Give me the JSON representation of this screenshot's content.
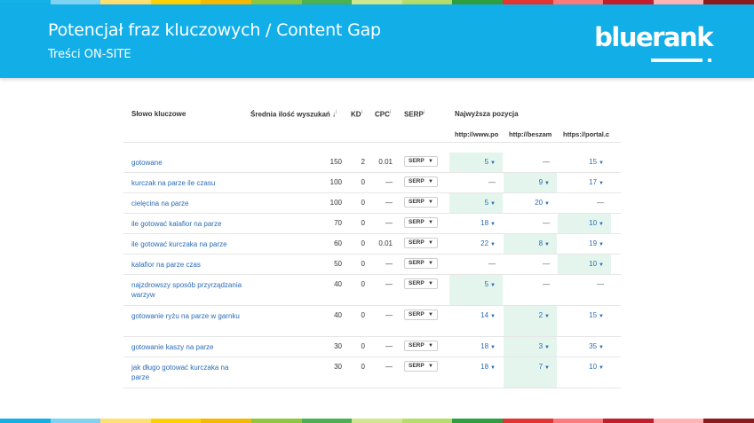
{
  "stripe_colors": [
    "#13b0e6",
    "#7fd3f2",
    "#ffe070",
    "#ffd000",
    "#f5b800",
    "#8dc63f",
    "#4caf50",
    "#cfe78f",
    "#b6dc6a",
    "#2e9e3e",
    "#e3342f",
    "#ff7a7a",
    "#c11d2a",
    "#ffb3b3",
    "#8c1b1b"
  ],
  "header": {
    "title": "Potencjał fraz kluczowych / Content Gap",
    "subtitle": "Treści ON-SITE",
    "logo": "bluerank"
  },
  "table": {
    "columns": {
      "keyword": "Słowo kluczowe",
      "volume": "Średnia ilość wyszukań",
      "volume_sort": "↓",
      "kd": "KD",
      "cpc": "CPC",
      "serp": "SERP",
      "best_position": "Najwyższa pozycja",
      "info_mark": "i"
    },
    "domains": [
      "http://www.po",
      "http://beszam",
      "https://portal.c"
    ],
    "serp_label": "SERP",
    "rows": [
      {
        "keyword": "gotowane",
        "volume": "150",
        "kd": "2",
        "cpc": "0.01",
        "pos": [
          "5",
          "—",
          "15"
        ],
        "green": [
          true,
          false,
          false
        ]
      },
      {
        "keyword": "kurczak na parze ile czasu",
        "volume": "100",
        "kd": "0",
        "cpc": "—",
        "pos": [
          "—",
          "9",
          "17"
        ],
        "green": [
          false,
          true,
          false
        ]
      },
      {
        "keyword": "cielęcina na parze",
        "volume": "100",
        "kd": "0",
        "cpc": "—",
        "pos": [
          "5",
          "20",
          "—"
        ],
        "green": [
          true,
          false,
          false
        ]
      },
      {
        "keyword": "ile gotować kalafior na parze",
        "volume": "70",
        "kd": "0",
        "cpc": "—",
        "pos": [
          "18",
          "—",
          "10"
        ],
        "green": [
          false,
          false,
          true
        ]
      },
      {
        "keyword": "ile gotować kurczaka na parze",
        "volume": "60",
        "kd": "0",
        "cpc": "0.01",
        "pos": [
          "22",
          "8",
          "19"
        ],
        "green": [
          false,
          true,
          false
        ]
      },
      {
        "keyword": "kalafior na parze czas",
        "volume": "50",
        "kd": "0",
        "cpc": "—",
        "pos": [
          "—",
          "—",
          "10"
        ],
        "green": [
          false,
          false,
          true
        ]
      },
      {
        "keyword": "najzdrowszy sposób przyrządzania warzyw",
        "volume": "40",
        "kd": "0",
        "cpc": "—",
        "pos": [
          "5",
          "—",
          "—"
        ],
        "green": [
          true,
          false,
          false
        ]
      },
      {
        "keyword": "gotowanie ryżu na parze w garnku",
        "volume": "40",
        "kd": "0",
        "cpc": "—",
        "pos": [
          "14",
          "2",
          "15"
        ],
        "green": [
          false,
          true,
          false
        ]
      },
      {
        "keyword": "gotowanie kaszy na parze",
        "volume": "30",
        "kd": "0",
        "cpc": "—",
        "pos": [
          "18",
          "3",
          "35"
        ],
        "green": [
          false,
          true,
          false
        ]
      },
      {
        "keyword": "jak długo gotować kurczaka na parze",
        "volume": "30",
        "kd": "0",
        "cpc": "—",
        "pos": [
          "18",
          "7",
          "10"
        ],
        "green": [
          false,
          true,
          false
        ]
      }
    ]
  }
}
